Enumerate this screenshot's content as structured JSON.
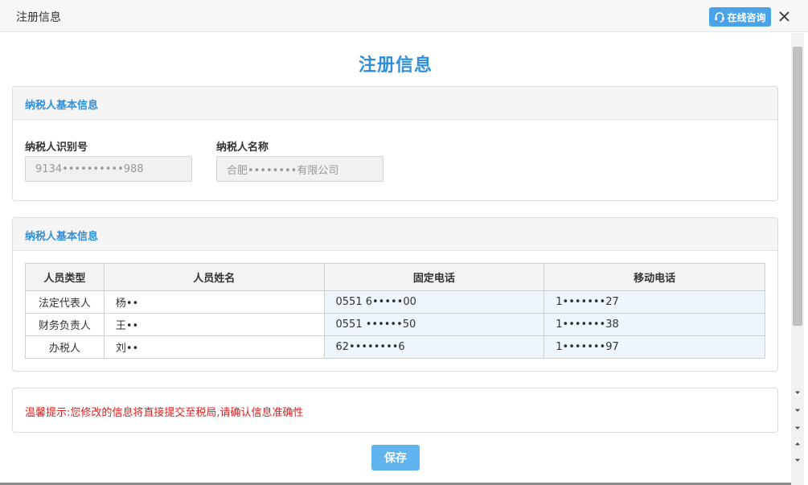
{
  "window": {
    "title": "注册信息",
    "consult_label": "在线咨询",
    "close_symbol": "✕"
  },
  "page": {
    "heading": "注册信息"
  },
  "basic_info": {
    "header": "纳税人基本信息",
    "tax_id_label": "纳税人识别号",
    "tax_id_value": "9134••••••••••988",
    "name_label": "纳税人名称",
    "name_value": "合肥••••••••有限公司"
  },
  "people_info": {
    "header": "纳税人基本信息",
    "columns": [
      "人员类型",
      "人员姓名",
      "固定电话",
      "移动电话"
    ],
    "rows": [
      {
        "type": "法定代表人",
        "name": "杨••",
        "landline": "0551 6•••••00",
        "mobile": "1•••••••27"
      },
      {
        "type": "财务负责人",
        "name": "王••",
        "landline": "0551 ••••••50",
        "mobile": "1•••••••38"
      },
      {
        "type": "办税人",
        "name": "刘••",
        "landline": "62••••••••6",
        "mobile": "1•••••••97"
      }
    ]
  },
  "notice": {
    "text": "温馨提示:您修改的信息将直接提交至税局,请确认信息准确性"
  },
  "actions": {
    "save_label": "保存"
  },
  "colors": {
    "accent": "#2f8fdb",
    "button": "#5fb4ef",
    "warning": "#e02020"
  },
  "icons": {
    "consult": "headset-icon",
    "close": "close-icon",
    "scroll_down": "chevron-down-icon",
    "scroll_up": "chevron-up-icon"
  }
}
